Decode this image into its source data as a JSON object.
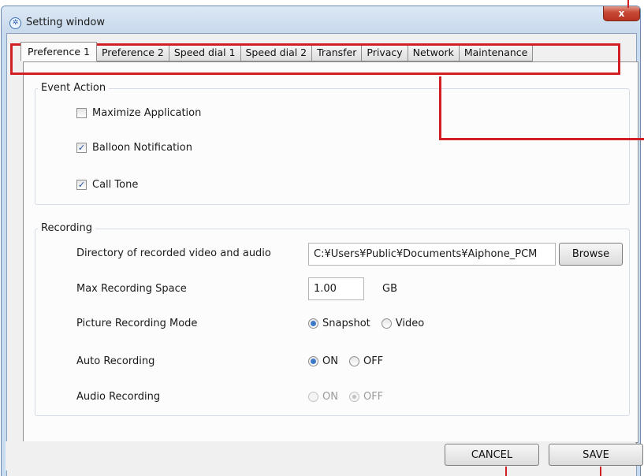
{
  "window": {
    "title": "Setting window",
    "close_glyph": "x"
  },
  "tabs": [
    {
      "label": "Preference 1",
      "active": true
    },
    {
      "label": "Preference 2"
    },
    {
      "label": "Speed dial 1"
    },
    {
      "label": "Speed dial 2"
    },
    {
      "label": "Transfer"
    },
    {
      "label": "Privacy"
    },
    {
      "label": "Network"
    },
    {
      "label": "Maintenance"
    }
  ],
  "event_action": {
    "legend": "Event Action",
    "options": [
      {
        "label": "Maximize Application",
        "checked": false
      },
      {
        "label": "Balloon Notification",
        "checked": true
      },
      {
        "label": "Call Tone",
        "checked": true
      }
    ]
  },
  "recording": {
    "legend": "Recording",
    "directory_label": "Directory of recorded video and audio",
    "directory_value": "C:¥Users¥Public¥Documents¥Aiphone_PCM",
    "browse_label": "Browse",
    "max_space_label": "Max Recording Space",
    "max_space_value": "1.00",
    "max_space_unit": "GB",
    "picture_mode_label": "Picture Recording Mode",
    "picture_mode_options": [
      "Snapshot",
      "Video"
    ],
    "picture_mode_selected": "Snapshot",
    "auto_label": "Auto Recording",
    "auto_options": [
      "ON",
      "OFF"
    ],
    "auto_selected": "ON",
    "audio_label": "Audio Recording",
    "audio_options": [
      "ON",
      "OFF"
    ],
    "audio_selected": "OFF",
    "audio_enabled": false
  },
  "footer": {
    "cancel_label": "CANCEL",
    "save_label": "SAVE"
  },
  "annotation_color": "#d01f25"
}
